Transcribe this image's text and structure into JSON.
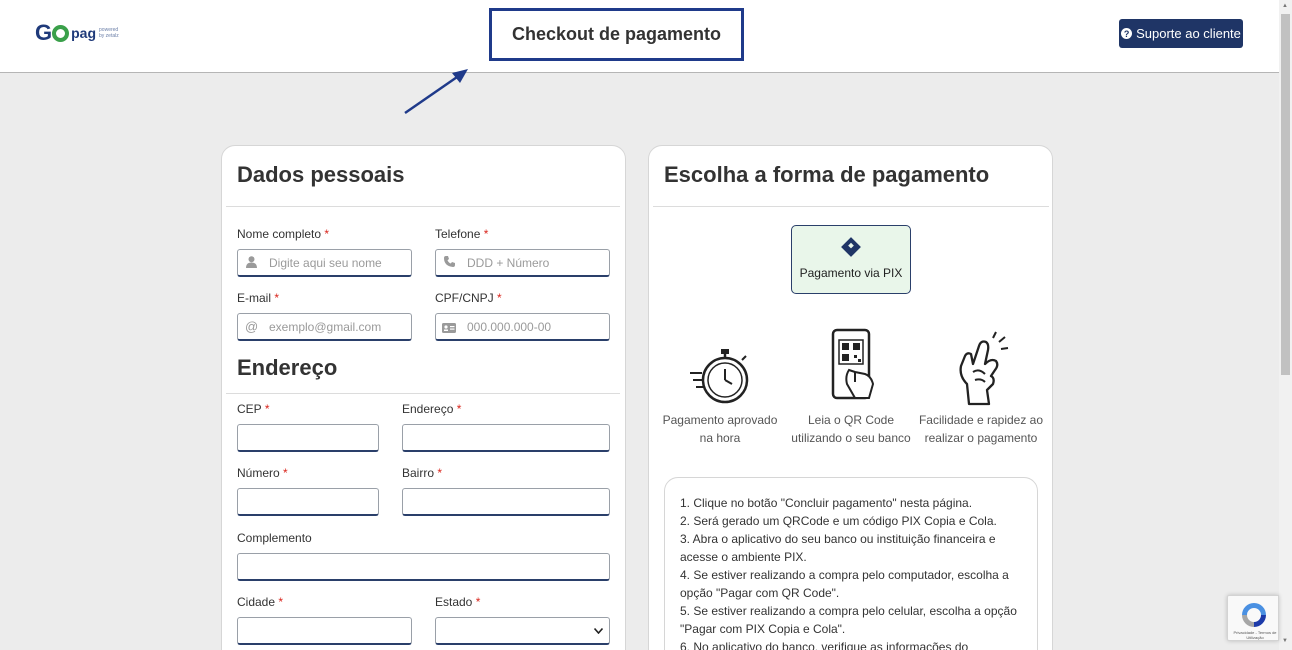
{
  "header": {
    "logo": {
      "go": "G",
      "pag": "pag",
      "powered": "powered by zetalz"
    },
    "title": "Checkout de pagamento",
    "support_button": "Suporte ao cliente"
  },
  "personal": {
    "title": "Dados pessoais",
    "name_label": "Nome completo",
    "name_placeholder": "Digite aqui seu nome",
    "phone_label": "Telefone",
    "phone_placeholder": "DDD + Número",
    "email_label": "E-mail",
    "email_placeholder": "exemplo@gmail.com",
    "cpf_label": "CPF/CNPJ",
    "cpf_placeholder": "000.000.000-00",
    "required_mark": "*"
  },
  "address": {
    "title": "Endereço",
    "cep_label": "CEP",
    "street_label": "Endereço",
    "number_label": "Número",
    "district_label": "Bairro",
    "complement_label": "Complemento",
    "city_label": "Cidade",
    "state_label": "Estado"
  },
  "payment": {
    "title": "Escolha a forma de pagamento",
    "pix_option": "Pagamento via PIX",
    "features": [
      {
        "icon": "stopwatch-icon",
        "text": "Pagamento aprovado na hora"
      },
      {
        "icon": "phone-qr-icon",
        "text": "Leia o QR Code utilizando o seu banco"
      },
      {
        "icon": "snap-fingers-icon",
        "text": "Facilidade e rapidez ao realizar o pagamento"
      }
    ],
    "instructions": [
      "1. Clique no botão \"Concluir pagamento\" nesta página.",
      "2. Será gerado um QRCode e um código PIX Copia e Cola.",
      "3. Abra o aplicativo do seu banco ou instituição financeira e acesse o ambiente PIX.",
      "4. Se estiver realizando a compra pelo computador, escolha a opção \"Pagar com QR Code\".",
      "5. Se estiver realizando a compra pelo celular, escolha a opção \"Pagar com PIX Copia e Cola\".",
      "6. No aplicativo do banco, verifique as informações do"
    ]
  },
  "recaptcha": {
    "text": "Privacidade - Termos de Utilização"
  },
  "colors": {
    "navy": "#1f3566",
    "title_border": "#1f3a8a",
    "logo_green": "#3aa04a",
    "pix_bg": "#e9f6ea",
    "required": "#d9251c"
  }
}
